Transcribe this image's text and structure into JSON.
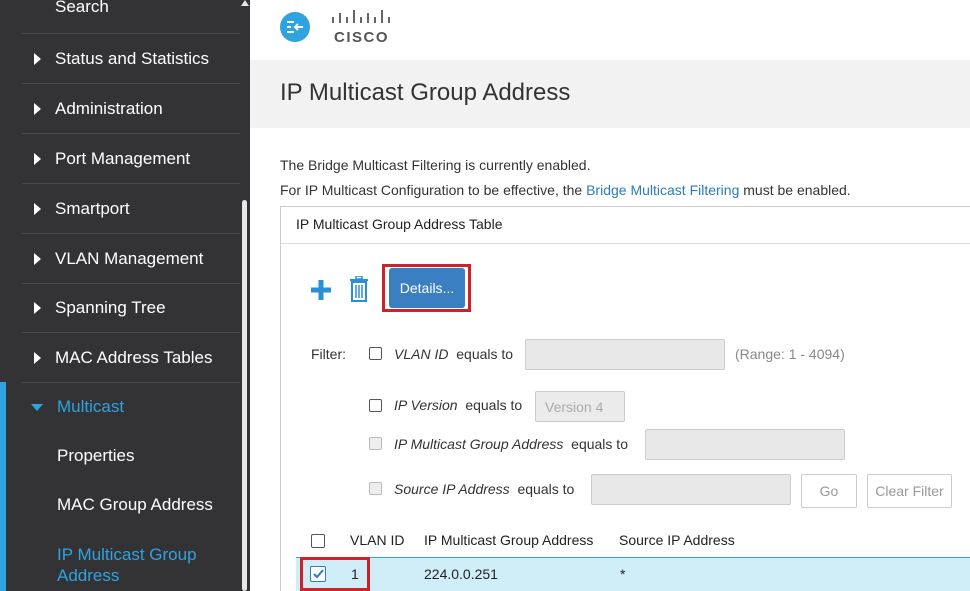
{
  "sidebar": {
    "search_label": "Search",
    "items": [
      {
        "label": "Status and Statistics"
      },
      {
        "label": "Administration"
      },
      {
        "label": "Port Management"
      },
      {
        "label": "Smartport"
      },
      {
        "label": "VLAN Management"
      },
      {
        "label": "Spanning Tree"
      },
      {
        "label": "MAC Address Tables"
      }
    ],
    "expanded": {
      "label": "Multicast"
    },
    "subitems": [
      {
        "label": "Properties"
      },
      {
        "label": "MAC Group Address"
      },
      {
        "label": "IP Multicast Group Address",
        "line1": "IP Multicast Group",
        "line2": "Address"
      }
    ]
  },
  "header": {
    "brand": "CISCO"
  },
  "page": {
    "title": "IP Multicast Group Address",
    "info_line1": "The Bridge Multicast Filtering is currently enabled.",
    "info_line2_prefix": "For IP Multicast Configuration to be effective, the ",
    "info_line2_link": "Bridge Multicast Filtering",
    "info_line2_suffix": " must be enabled."
  },
  "table": {
    "title": "IP Multicast Group Address Table",
    "details_button": "Details...",
    "filter": {
      "label": "Filter:",
      "vlan_field": "VLAN ID",
      "vlan_op": "equals to",
      "vlan_range": "(Range: 1 - 4094)",
      "ipver_field": "IP Version",
      "ipver_op": "equals to",
      "ipver_value": "Version 4",
      "group_field": "IP Multicast Group Address",
      "group_op": "equals to",
      "source_field": "Source IP Address",
      "source_op": "equals to",
      "go_button": "Go",
      "clear_button": "Clear Filter"
    },
    "columns": [
      "VLAN ID",
      "IP Multicast Group Address",
      "Source IP Address"
    ],
    "rows": [
      {
        "vlan": "1",
        "group": "224.0.0.251",
        "source": "*",
        "checked": true
      }
    ]
  },
  "colors": {
    "accent": "#2ea3e0",
    "sidebar_bg": "#333336",
    "highlight": "#cc2229",
    "primary_button": "#3a7fc1"
  }
}
